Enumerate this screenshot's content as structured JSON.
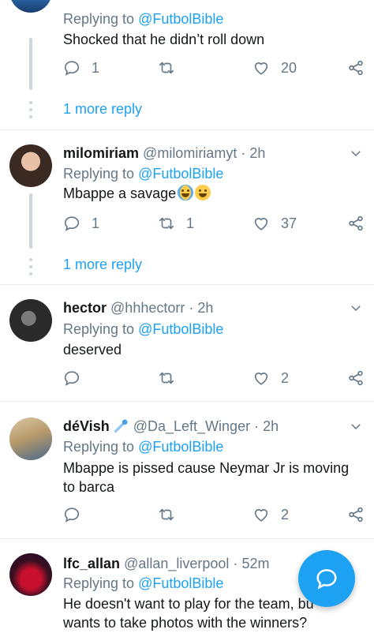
{
  "colors": {
    "accent": "#1da1f2",
    "secondary_text": "#657786",
    "divider": "#e6ecf0"
  },
  "tweets": [
    {
      "replying_prefix": "Replying to",
      "replying_to": "@FutbolBible",
      "text": "Shocked that he didn’t roll down",
      "reply_count": "1",
      "retweet_count": "",
      "like_count": "20",
      "more_replies": "1 more reply"
    },
    {
      "name": "milomiriam",
      "handle": "@milomiriamyt",
      "separator": "·",
      "time": "2h",
      "replying_prefix": "Replying to",
      "replying_to": "@FutbolBible",
      "text": "Mbappe a savage",
      "emojis": [
        "loudly-crying-face",
        "tears-of-joy-face"
      ],
      "reply_count": "1",
      "retweet_count": "1",
      "like_count": "37",
      "more_replies": "1 more reply"
    },
    {
      "name": "hector",
      "handle": "@hhhectorr",
      "separator": "·",
      "time": "2h",
      "replying_prefix": "Replying to",
      "replying_to": "@FutbolBible",
      "text": "deserved",
      "reply_count": "",
      "retweet_count": "",
      "like_count": "2"
    },
    {
      "name": "déVish",
      "name_emoji": "comet",
      "handle": "@Da_Left_Winger",
      "separator": "·",
      "time": "2h",
      "replying_prefix": "Replying to",
      "replying_to": "@FutbolBible",
      "text_line1": "Mbappe is pissed cause Neymar Jr is moving",
      "text_line2": "to barca",
      "reply_count": "",
      "retweet_count": "",
      "like_count": "2"
    },
    {
      "name": "lfc_allan",
      "handle": "@allan_liverpool",
      "separator": "·",
      "time": "52m",
      "replying_prefix": "Replying to",
      "replying_to": "@FutbolBible",
      "text_line1": "He doesn't want to play for the team, bu",
      "text_line2": "wants to take photos with the winners?"
    }
  ],
  "icons": {
    "reply": "reply-icon",
    "retweet": "retweet-icon",
    "like": "heart-icon",
    "share": "share-icon",
    "caret": "chevron-down-icon",
    "compose": "compose-reply-icon"
  }
}
